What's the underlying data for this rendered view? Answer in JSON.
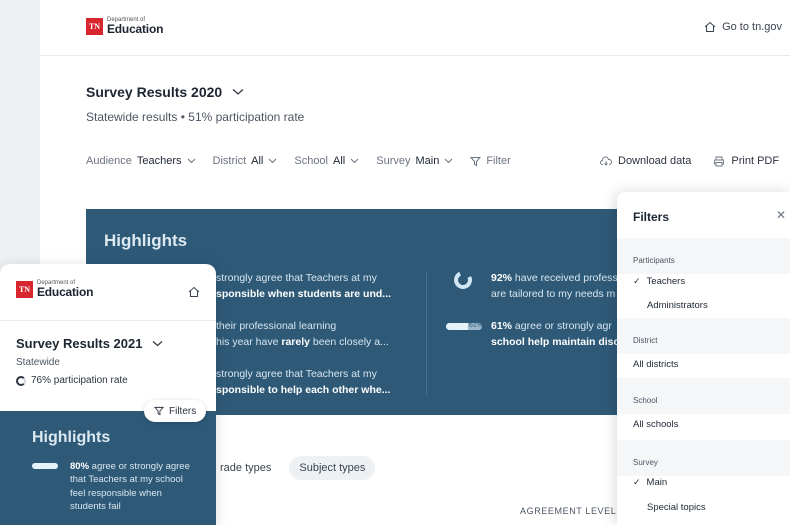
{
  "main": {
    "logo": {
      "small": "Department of",
      "big": "Education",
      "badge": "TN"
    },
    "goto_label": "Go to tn.gov",
    "survey_title": "Survey Results 2020",
    "subtitle_left": "Statewide results",
    "subtitle_right": "51% participation rate",
    "filters": [
      {
        "label": "Audience",
        "value": "Teachers"
      },
      {
        "label": "District",
        "value": "All"
      },
      {
        "label": "School",
        "value": "All"
      },
      {
        "label": "Survey",
        "value": "Main"
      }
    ],
    "filter_label": "Filter",
    "download_label": "Download data",
    "print_label": "Print PDF",
    "highlights_title": "Highlights",
    "stat1": "strongly agree that Teachers at my",
    "stat1b": "sponsible when students are und...",
    "stat2": "their professional learning",
    "stat2b_pre": "his year have ",
    "stat2b_bold": "rarely",
    "stat2b_post": " been closely a...",
    "stat3": "strongly agree that Teachers at my",
    "stat3b": "sponsible to help each other whe...",
    "stat4_pct": "92%",
    "stat4": " have received profess",
    "stat4b": "are tailored to my needs m",
    "stat5_pct": "61%",
    "stat5": " agree or strongly agr",
    "stat5b": "school help maintain disci",
    "bar_label": "61%",
    "bar_value": 0.61,
    "tabs": [
      "rade types",
      "Subject types"
    ],
    "agreement_label": "AGREEMENT LEVEL"
  },
  "card": {
    "logo": {
      "small": "Department of",
      "big": "Education",
      "badge": "TN"
    },
    "survey_title": "Survey Results 2021",
    "statewide": "Statewide",
    "rate": "76% participation rate",
    "filters_btn": "Filters",
    "highlights_title": "Highlights",
    "stat_pct": "80%",
    "stat_text": " agree or strongly agree that Teachers at my school feel responsible when students fail",
    "bar_value": 0.8
  },
  "panel": {
    "title": "Filters",
    "participants": "Participants",
    "teachers": "Teachers",
    "administrators": "Administrators",
    "district": "District",
    "all_districts": "All districts",
    "school": "School",
    "all_schools": "All schools",
    "survey": "Survey",
    "main": "Main",
    "special": "Special topics"
  },
  "colors": {
    "accent": "#2e5a78",
    "brand_red": "#d8262e"
  }
}
